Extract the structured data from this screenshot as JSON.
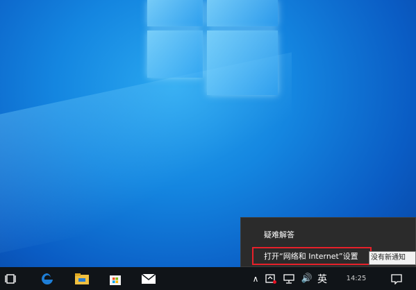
{
  "context_menu": {
    "items": [
      "疑难解答",
      "打开“网络和 Internet”设置"
    ]
  },
  "tooltip": {
    "text": "没有新通知"
  },
  "taskbar": {
    "pinned": [
      "task-view-icon",
      "edge-icon",
      "file-explorer-icon",
      "store-icon",
      "mail-icon"
    ],
    "tray": {
      "chevron": "∧",
      "volume": "🔊",
      "language": "英",
      "clock": "14:25"
    }
  },
  "colors": {
    "highlight": "#e8202a",
    "menu_bg": "#2b2b2b",
    "taskbar_bg": "#101418",
    "edge_blue": "#1e7fd8"
  }
}
